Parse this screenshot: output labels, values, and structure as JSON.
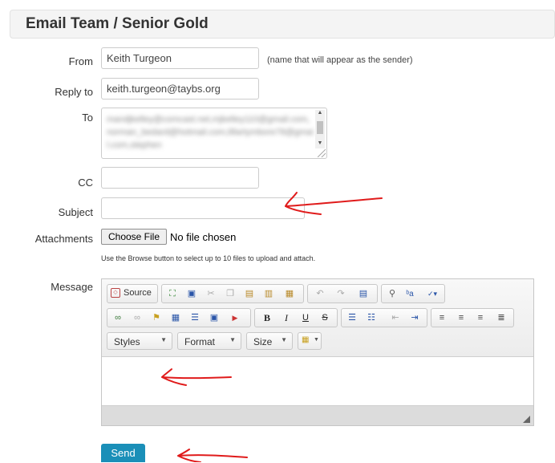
{
  "page": {
    "title": "Email Team / Senior Gold"
  },
  "form": {
    "from_label": "From",
    "from_value": "Keith Turgeon",
    "from_hint": "(name that will appear as the sender)",
    "reply_label": "Reply to",
    "reply_value": "keith.turgeon@taybs.org",
    "to_label": "To",
    "to_value": "mandjkelley@comcast.net,mjkelley110@gmail.com,norman_bedard@hotmail.com,lillartymbore78@gmail.com,stephen",
    "cc_label": "CC",
    "cc_value": "",
    "subject_label": "Subject",
    "subject_value": "",
    "attachments_label": "Attachments",
    "choose_file_label": "Choose File",
    "no_file_text": "No file chosen",
    "attach_hint": "Use the Browse button to select up to 10 files to upload and attach.",
    "message_label": "Message",
    "send_label": "Send"
  },
  "editor": {
    "source_label": "Source",
    "styles_label": "Styles",
    "format_label": "Format",
    "size_label": "Size",
    "bold_glyph": "B",
    "italic_glyph": "I",
    "underline_glyph": "U",
    "strike_glyph": "S",
    "body_text": ""
  },
  "annotations": {
    "arrow_color": "#e01b1b"
  }
}
